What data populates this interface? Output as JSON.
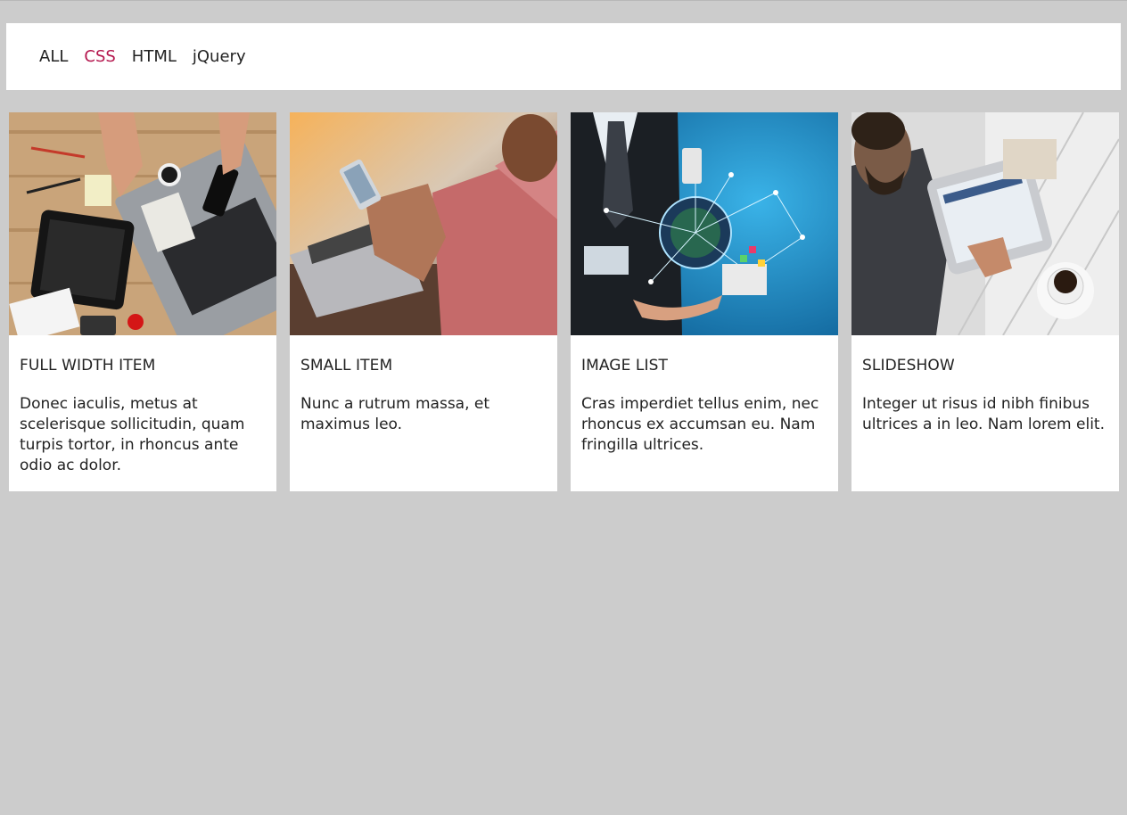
{
  "filters": [
    {
      "label": "ALL",
      "active": false
    },
    {
      "label": "CSS",
      "active": true
    },
    {
      "label": "HTML",
      "active": false
    },
    {
      "label": "jQuery",
      "active": false
    }
  ],
  "accent_color": "#b5174e",
  "cards": [
    {
      "title": "FULL WIDTH ITEM",
      "text": "Donec iaculis, metus at scelerisque sollicitudin, quam turpis tortor, in rhoncus ante odio ac dolor.",
      "image": "desk-with-laptop-tablet-photo"
    },
    {
      "title": "SMALL ITEM",
      "text": "Nunc a rutrum massa, et maximus leo.",
      "image": "person-using-phone-photo"
    },
    {
      "title": "IMAGE LIST",
      "text": "Cras imperdiet tellus enim, nec rhoncus ex accumsan eu. Nam fringilla ultrices.",
      "image": "businessman-technology-globe-photo"
    },
    {
      "title": "SLIDESHOW",
      "text": "Integer ut risus id nibh finibus ultrices a in leo. Nam lorem elit.",
      "image": "man-with-tablet-photo"
    }
  ]
}
